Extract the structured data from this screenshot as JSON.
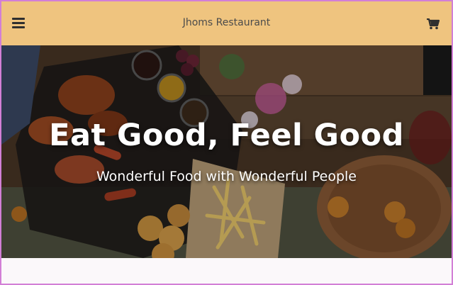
{
  "navbar": {
    "brand": "Jhoms Restaurant",
    "menu_icon": "hamburger-menu-icon",
    "cart_icon": "shopping-cart-icon",
    "background": "#efc47f"
  },
  "hero": {
    "title": "Eat Good, Feel Good",
    "subtitle": "Wonderful Food with Wonderful People"
  }
}
